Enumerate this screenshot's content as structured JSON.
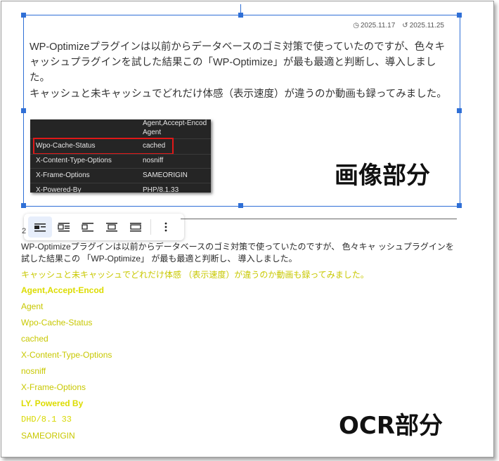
{
  "meta": {
    "published_date": "2025.11.17",
    "updated_date": "2025.11.25"
  },
  "article": {
    "paragraph1": "WP-Optimizeプラグインは以前からデータベースのゴミ対策で使っていたのですが、色々キャッシュプラグインを試した結果この「WP-Optimize」が最も最適と判断し、導入しました。",
    "paragraph2": "キャッシュと未キャッシュでどれだけ体感（表示速度）が違うのか動画も録ってみました。"
  },
  "screenshot_table": {
    "rows": [
      {
        "key": "",
        "value": "Agent,Accept-Encod"
      },
      {
        "key": "",
        "value": "Agent"
      },
      {
        "key": "Wpo-Cache-Status",
        "value": "cached"
      },
      {
        "key": "X-Content-Type-Options",
        "value": "nosniff"
      },
      {
        "key": "X-Frame-Options",
        "value": "SAMEORIGIN"
      },
      {
        "key": "X-Powered-By",
        "value": "PHP/8.1.33"
      }
    ]
  },
  "labels": {
    "image_part": "画像部分",
    "ocr_part": "OCR部分"
  },
  "toolbar": {
    "buttons": [
      "align-left-inline",
      "align-left-wrap",
      "align-left",
      "align-center",
      "align-full",
      "more-options"
    ]
  },
  "stray_char": "2",
  "ocr_output": {
    "paragraph1": "WP-Optimizeプラグインは以前からデータベースのゴミ対策で使っていたのですが、 色々キャ ッシュプラグインを試した結果この 「WP-Optimize」 が最も最適と判断し、 導入しました。",
    "paragraph2": "キャッシュと未キャッシュでどれだけ体感 （表示速度）が違うのか動画も録ってみました。",
    "lines": [
      "Agent,Accept-Encod",
      "Agent",
      "Wpo-Cache-Status",
      "cached",
      "X-Content-Type-Options",
      "nosniff",
      "X-Frame-Options",
      "LY. Powered By",
      "DHD/8.1 33",
      "SAMEORIGIN"
    ]
  },
  "colors": {
    "selection": "#2f6fd6",
    "highlight": "#e01818",
    "ocr_yellow": "#c8c800"
  }
}
